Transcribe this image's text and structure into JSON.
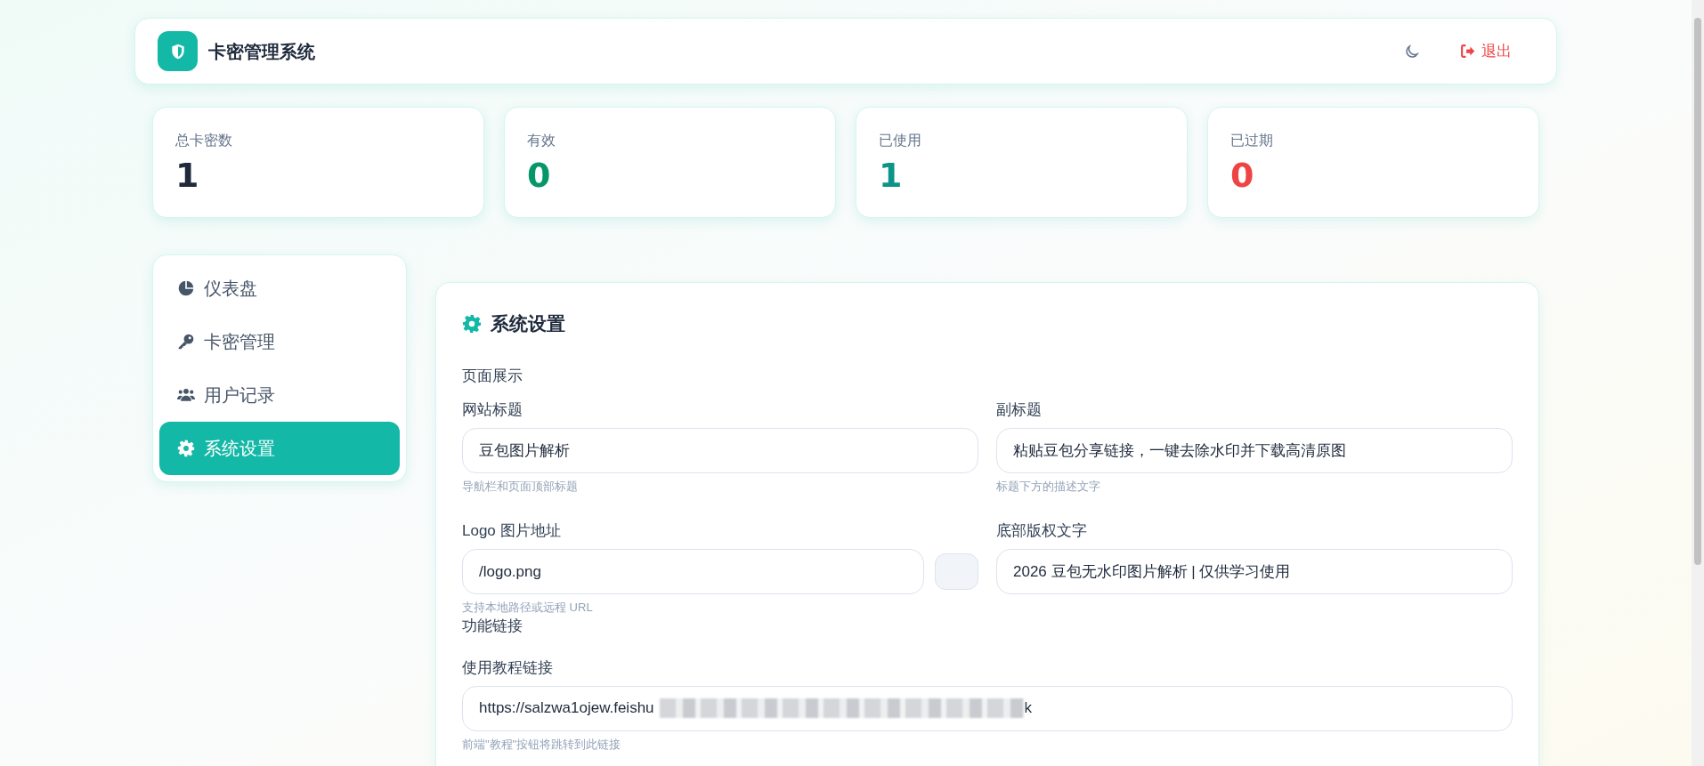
{
  "header": {
    "title": "卡密管理系统",
    "logout": "退出"
  },
  "stats": [
    {
      "label": "总卡密数",
      "value": "1",
      "color": "#1e293b"
    },
    {
      "label": "有效",
      "value": "0",
      "color": "#059669"
    },
    {
      "label": "已使用",
      "value": "1",
      "color": "#0d9488"
    },
    {
      "label": "已过期",
      "value": "0",
      "color": "#ef4444"
    }
  ],
  "sidebar": {
    "items": [
      {
        "label": "仪表盘",
        "kind": "chart",
        "selected": false
      },
      {
        "label": "卡密管理",
        "kind": "key",
        "selected": false
      },
      {
        "label": "用户记录",
        "kind": "users",
        "selected": false
      },
      {
        "label": "系统设置",
        "kind": "gear",
        "selected": true
      }
    ]
  },
  "settings": {
    "title": "系统设置",
    "sections": [
      {
        "heading": "页面展示",
        "rows": [
          [
            {
              "label": "网站标题",
              "value": "豆包图片解析",
              "hint": "导航栏和页面顶部标题"
            },
            {
              "label": "副标题",
              "value": "粘贴豆包分享链接，一键去除水印并下载高清原图",
              "hint": "标题下方的描述文字"
            }
          ],
          [
            {
              "label": "Logo 图片地址",
              "value": "/logo.png",
              "hint": "支持本地路径或远程 URL",
              "preview": true
            },
            {
              "label": "底部版权文字",
              "value": "2026 豆包无水印图片解析 | 仅供学习使用"
            }
          ]
        ]
      },
      {
        "heading": "功能链接",
        "rows": [
          [
            {
              "label": "使用教程链接",
              "value": "https://salzwa1ojew.feishu",
              "redacted": true,
              "value_end": "k",
              "hint": "前端\"教程\"按钮将跳转到此链接"
            }
          ]
        ]
      }
    ]
  }
}
